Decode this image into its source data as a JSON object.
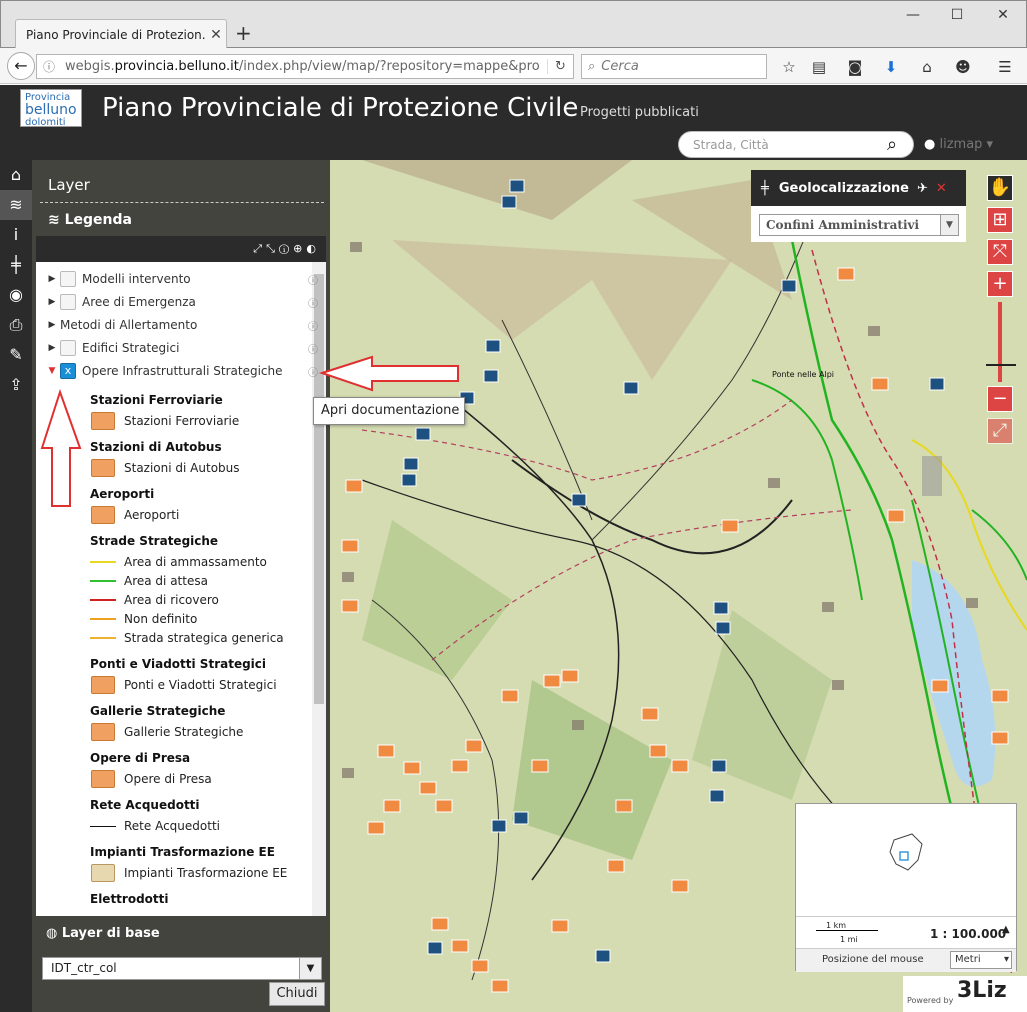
{
  "browser": {
    "tab_title": "Piano Provinciale di Protezion...",
    "url_prefix": "webgis.",
    "url_domain": "provincia.belluno.it",
    "url_suffix": "/index.php/view/map/?repository=mappe&pro",
    "search_placeholder": "Cerca"
  },
  "header": {
    "logo_line1": "Provincia",
    "logo_line2": "belluno",
    "logo_line3": "dolomiti",
    "title": "Piano Provinciale di Protezione Civile",
    "subtitle": "Progetti pubblicati",
    "search_placeholder": "Strada, Città",
    "user": "lizmap"
  },
  "panel": {
    "title": "Layer",
    "legend_title": "Legenda",
    "layers": [
      {
        "label": "Modelli intervento",
        "expanded": false,
        "checked": false
      },
      {
        "label": "Aree di Emergenza",
        "expanded": false,
        "checked": false
      },
      {
        "label": "Metodi di Allertamento",
        "expanded": false,
        "checked": null
      },
      {
        "label": "Edifici Strategici",
        "expanded": false,
        "checked": false
      },
      {
        "label": "Opere Infrastrutturali Strategiche",
        "expanded": true,
        "checked": true
      }
    ],
    "legend_groups": [
      {
        "title": "Stazioni Ferroviarie",
        "items": [
          {
            "label": "Stazioni Ferroviarie",
            "kind": "box"
          }
        ]
      },
      {
        "title": "Stazioni di Autobus",
        "items": [
          {
            "label": "Stazioni di Autobus",
            "kind": "box"
          }
        ]
      },
      {
        "title": "Aeroporti",
        "items": [
          {
            "label": "Aeroporti",
            "kind": "box"
          }
        ]
      },
      {
        "title": "Strade Strategiche",
        "items": [
          {
            "label": "Area di ammassamento",
            "kind": "line",
            "color": "#e8d820"
          },
          {
            "label": "Area di attesa",
            "kind": "line",
            "color": "#30c030"
          },
          {
            "label": "Area di ricovero",
            "kind": "line",
            "color": "#d02020"
          },
          {
            "label": "Non definito",
            "kind": "line",
            "color": "#f0a020"
          },
          {
            "label": "Strada strategica generica",
            "kind": "line",
            "color": "#f0b030"
          }
        ]
      },
      {
        "title": "Ponti e Viadotti Strategici",
        "items": [
          {
            "label": "Ponti e Viadotti Strategici",
            "kind": "box"
          }
        ]
      },
      {
        "title": "Gallerie Strategiche",
        "items": [
          {
            "label": "Gallerie Strategiche",
            "kind": "box"
          }
        ]
      },
      {
        "title": "Opere di Presa",
        "items": [
          {
            "label": "Opere di Presa",
            "kind": "box"
          }
        ]
      },
      {
        "title": "Rete Acquedotti",
        "items": [
          {
            "label": "Rete Acquedotti",
            "kind": "line",
            "color": "#111111"
          }
        ]
      },
      {
        "title": "Impianti Trasformazione EE",
        "items": [
          {
            "label": "Impianti Trasformazione EE",
            "kind": "box-grey"
          }
        ]
      },
      {
        "title": "Elettrodotti",
        "items": []
      }
    ],
    "base_layer_title": "Layer di base",
    "base_layer_value": "IDT_ctr_col",
    "close_label": "Chiudi"
  },
  "tooltip": "Apri documentazione",
  "geoloc": {
    "title": "Geolocalizzazione",
    "select_value": "Confini Amministrativi"
  },
  "map": {
    "town_label": "Ponte nelle Alpi"
  },
  "overview": {
    "scale_km": "1 km",
    "scale_mi": "1 mi",
    "scale_ratio": "1 : 100.000",
    "mouse_label": "Posizione del mouse",
    "units": "Metri"
  },
  "powered": {
    "label": "Powered by",
    "brand": "3Liz"
  },
  "colors": {
    "accent": "#dd4444",
    "panel_bg": "#2b2b2b",
    "check": "#1a8fd8",
    "annotation": "#e03030"
  }
}
